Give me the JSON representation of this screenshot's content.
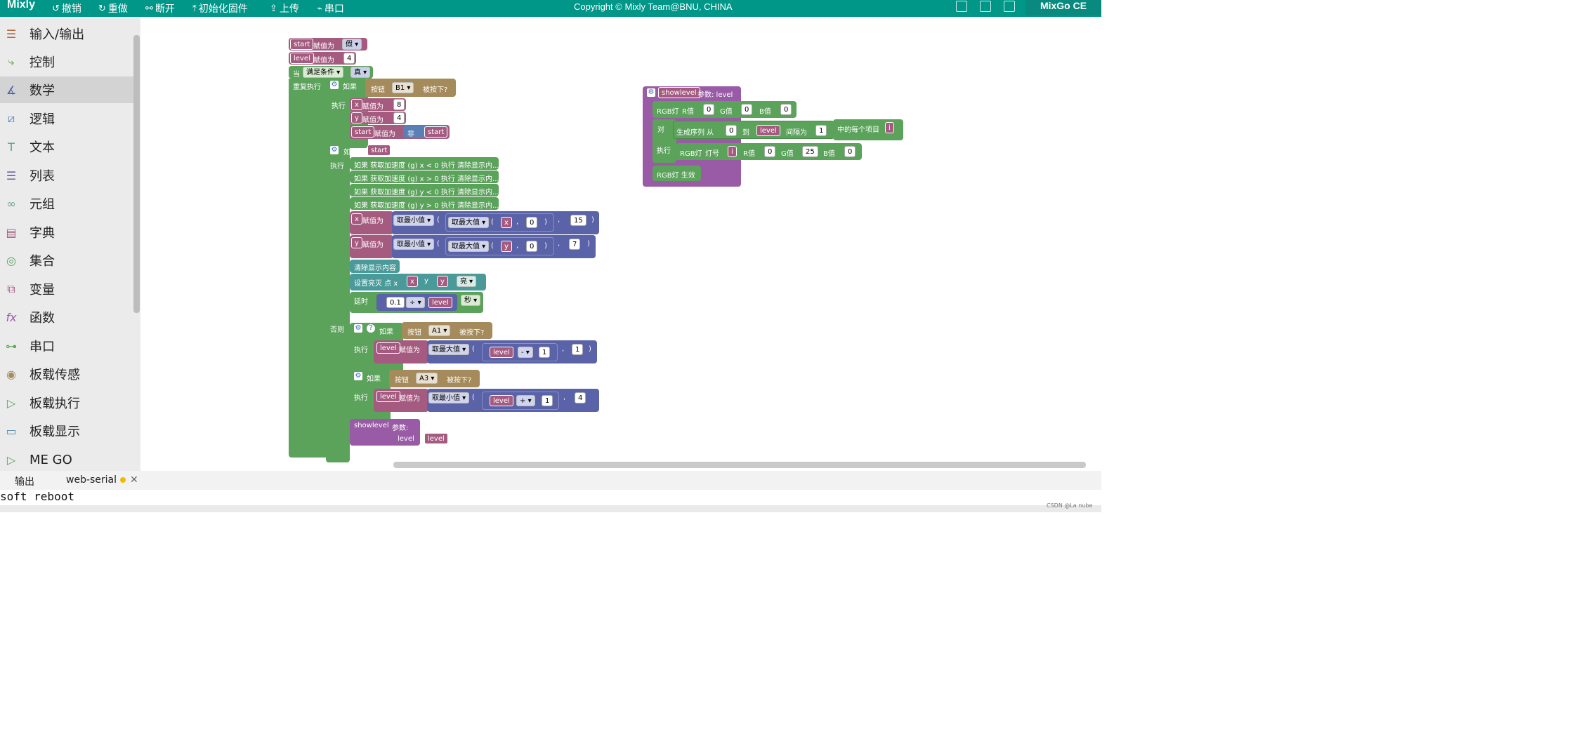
{
  "app": {
    "brand": "Mixly",
    "copyright": "Copyright © Mixly Team@BNU, CHINA",
    "board": "MixGo CE"
  },
  "toolbar": [
    {
      "icon": "undo-icon",
      "glyph": "↺",
      "label": "撤销"
    },
    {
      "icon": "redo-icon",
      "glyph": "↻",
      "label": "重做"
    },
    {
      "icon": "disconnect-icon",
      "glyph": "⚯",
      "label": "断开"
    },
    {
      "icon": "firmware-icon",
      "glyph": "⤒",
      "label": "初始化固件"
    },
    {
      "icon": "upload-icon",
      "glyph": "⇪",
      "label": "上传"
    },
    {
      "icon": "usb-icon",
      "glyph": "⌁",
      "label": "串口"
    }
  ],
  "sidebar": [
    {
      "label": "输入/输出",
      "icon": "io-icon",
      "color": "#b5683f"
    },
    {
      "label": "控制",
      "icon": "control-icon",
      "color": "#5b9a3c"
    },
    {
      "label": "数学",
      "icon": "math-icon",
      "color": "#4a5fa8",
      "selected": true
    },
    {
      "label": "逻辑",
      "icon": "logic-icon",
      "color": "#5a7fb5"
    },
    {
      "label": "文本",
      "icon": "text-icon",
      "color": "#5ba28a"
    },
    {
      "label": "列表",
      "icon": "list-icon",
      "color": "#745ba5"
    },
    {
      "label": "元组",
      "icon": "tuple-icon",
      "color": "#5ba28a"
    },
    {
      "label": "字典",
      "icon": "dict-icon",
      "color": "#a55b80"
    },
    {
      "label": "集合",
      "icon": "set-icon",
      "color": "#5ba25b"
    },
    {
      "label": "变量",
      "icon": "variable-icon",
      "color": "#a55b80"
    },
    {
      "label": "函数",
      "icon": "function-icon",
      "color": "#995ba5"
    },
    {
      "label": "串口",
      "icon": "serial-icon",
      "color": "#5ba25b"
    },
    {
      "label": "板载传感",
      "icon": "sensor-icon",
      "color": "#a58a5b"
    },
    {
      "label": "板载执行",
      "icon": "actuator-icon",
      "color": "#5ba25b"
    },
    {
      "label": "板载显示",
      "icon": "display-icon",
      "color": "#5b8aa5"
    },
    {
      "label": "ME GO",
      "icon": "mego-icon",
      "color": "#5ba25b"
    }
  ],
  "blocks": {
    "assign": "赋值为",
    "while": "当",
    "while_cond": "满足条件",
    "true": "真",
    "false": "假",
    "repeat": "重复执行",
    "if": "如果",
    "do": "执行",
    "else": "否则",
    "not": "非",
    "button": "按钮",
    "pressed": "被按下?",
    "btn_b1": "B1",
    "btn_a1": "A1",
    "btn_a3": "A3",
    "var_start": "start",
    "var_level": "level",
    "var_x": "x",
    "var_y": "y",
    "var_i": "i",
    "n4": "4",
    "n8": "8",
    "n0": "0",
    "n15": "15",
    "n7": "7",
    "n1": "1",
    "n25": "25",
    "n01": "0.1",
    "accel1": "如果 获取加速度 (g) x < 0 执行 清除显示内...",
    "accel2": "如果 获取加速度 (g) x > 0 执行 清除显示内...",
    "accel3": "如果 获取加速度 (g) y < 0 执行 清除显示内...",
    "accel4": "如果 获取加速度 (g) y > 0 执行 清除显示内...",
    "min": "取最小值",
    "max": "取最大值",
    "clear": "清除显示内容",
    "setpixel": "设置亮灭  点 x",
    "y": "y",
    "bright": "亮",
    "delay": "延时",
    "div": "÷",
    "sec": "秒",
    "minus": "-",
    "plus": "+",
    "proc": "showlevel",
    "param": "参数:",
    "param_levels": "参数:  level",
    "rgb": "RGB灯",
    "r": "R值",
    "g": "G值",
    "b": "B值",
    "for": "对",
    "range": "生成序列  从",
    "to": "到",
    "step": "间隔为",
    "each": "中的每个项目",
    "led_no": "灯号",
    "rgb_show": "RGB灯  生效",
    "comma": ",",
    "lp": "(",
    "rp": ")"
  },
  "bottom": {
    "tabs": [
      "输出",
      "web-serial"
    ],
    "console": "soft reboot",
    "watermark": "CSDN @La nube"
  }
}
